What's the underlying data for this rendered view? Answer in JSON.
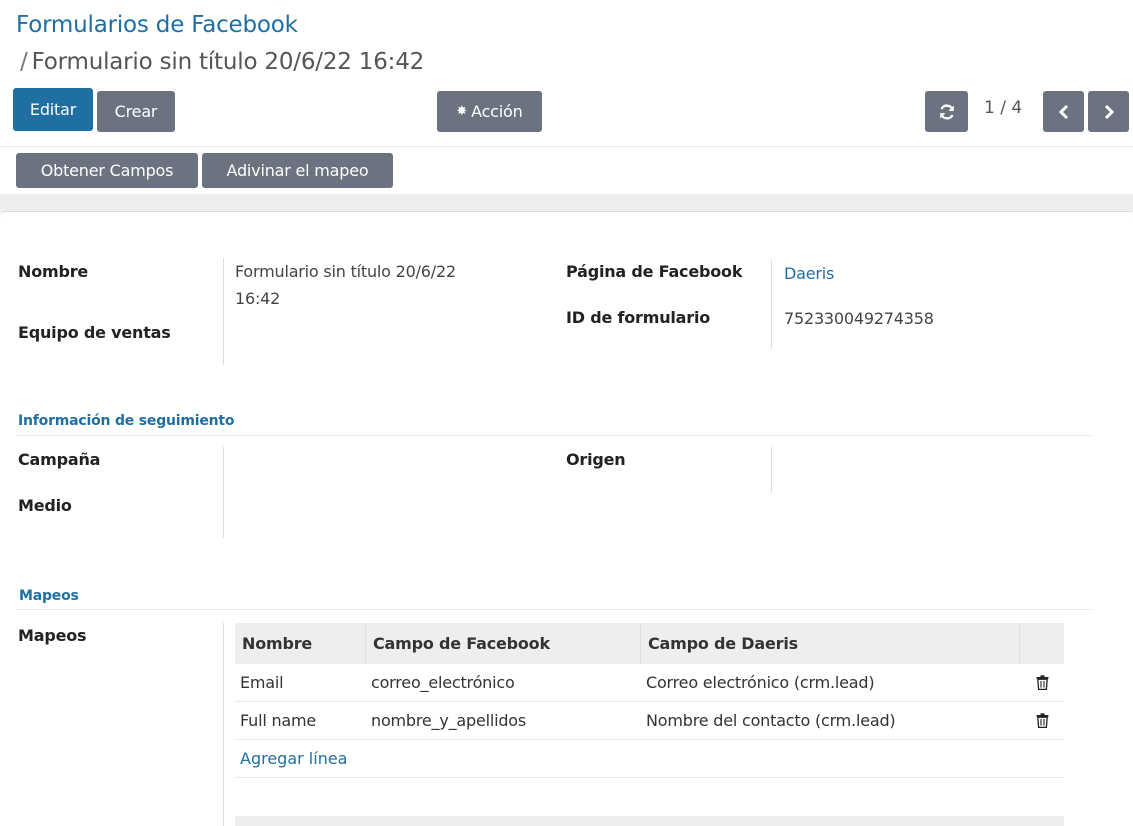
{
  "breadcrumb": {
    "root": "Formularios de Facebook",
    "separator": "/",
    "current": "Formulario sin título 20/6/22 16:42"
  },
  "toolbar": {
    "edit": "Editar",
    "create": "Crear",
    "action": "Acción",
    "pager": "1 / 4"
  },
  "header_buttons": {
    "get_fields": "Obtener Campos",
    "guess_mapping": "Adivinar el mapeo"
  },
  "form": {
    "name_label": "Nombre",
    "name_value_line1": "Formulario sin título 20/6/22",
    "name_value_line2": "16:42",
    "sales_team_label": "Equipo de ventas",
    "page_label": "Página de Facebook",
    "page_value": "Daeris",
    "form_id_label": "ID de formulario",
    "form_id_value": "752330049274358"
  },
  "tracking": {
    "title": "Información de seguimiento",
    "campaign_label": "Campaña",
    "medium_label": "Medio",
    "source_label": "Origen"
  },
  "mappings": {
    "title": "Mapeos",
    "field_label": "Mapeos",
    "columns": [
      "Nombre",
      "Campo de Facebook",
      "Campo de Daeris"
    ],
    "rows": [
      [
        "Email",
        "correo_electrónico",
        "Correo electrónico (crm.lead)"
      ],
      [
        "Full name",
        "nombre_y_apellidos",
        "Nombre del contacto (crm.lead)"
      ]
    ],
    "add_line": "Agregar línea"
  },
  "colors": {
    "primary": "#1f6fa3",
    "secondary_button": "#6b7280"
  },
  "icons": [
    "gear-icon",
    "refresh-icon",
    "chevron-left-icon",
    "chevron-right-icon",
    "trash-icon"
  ]
}
